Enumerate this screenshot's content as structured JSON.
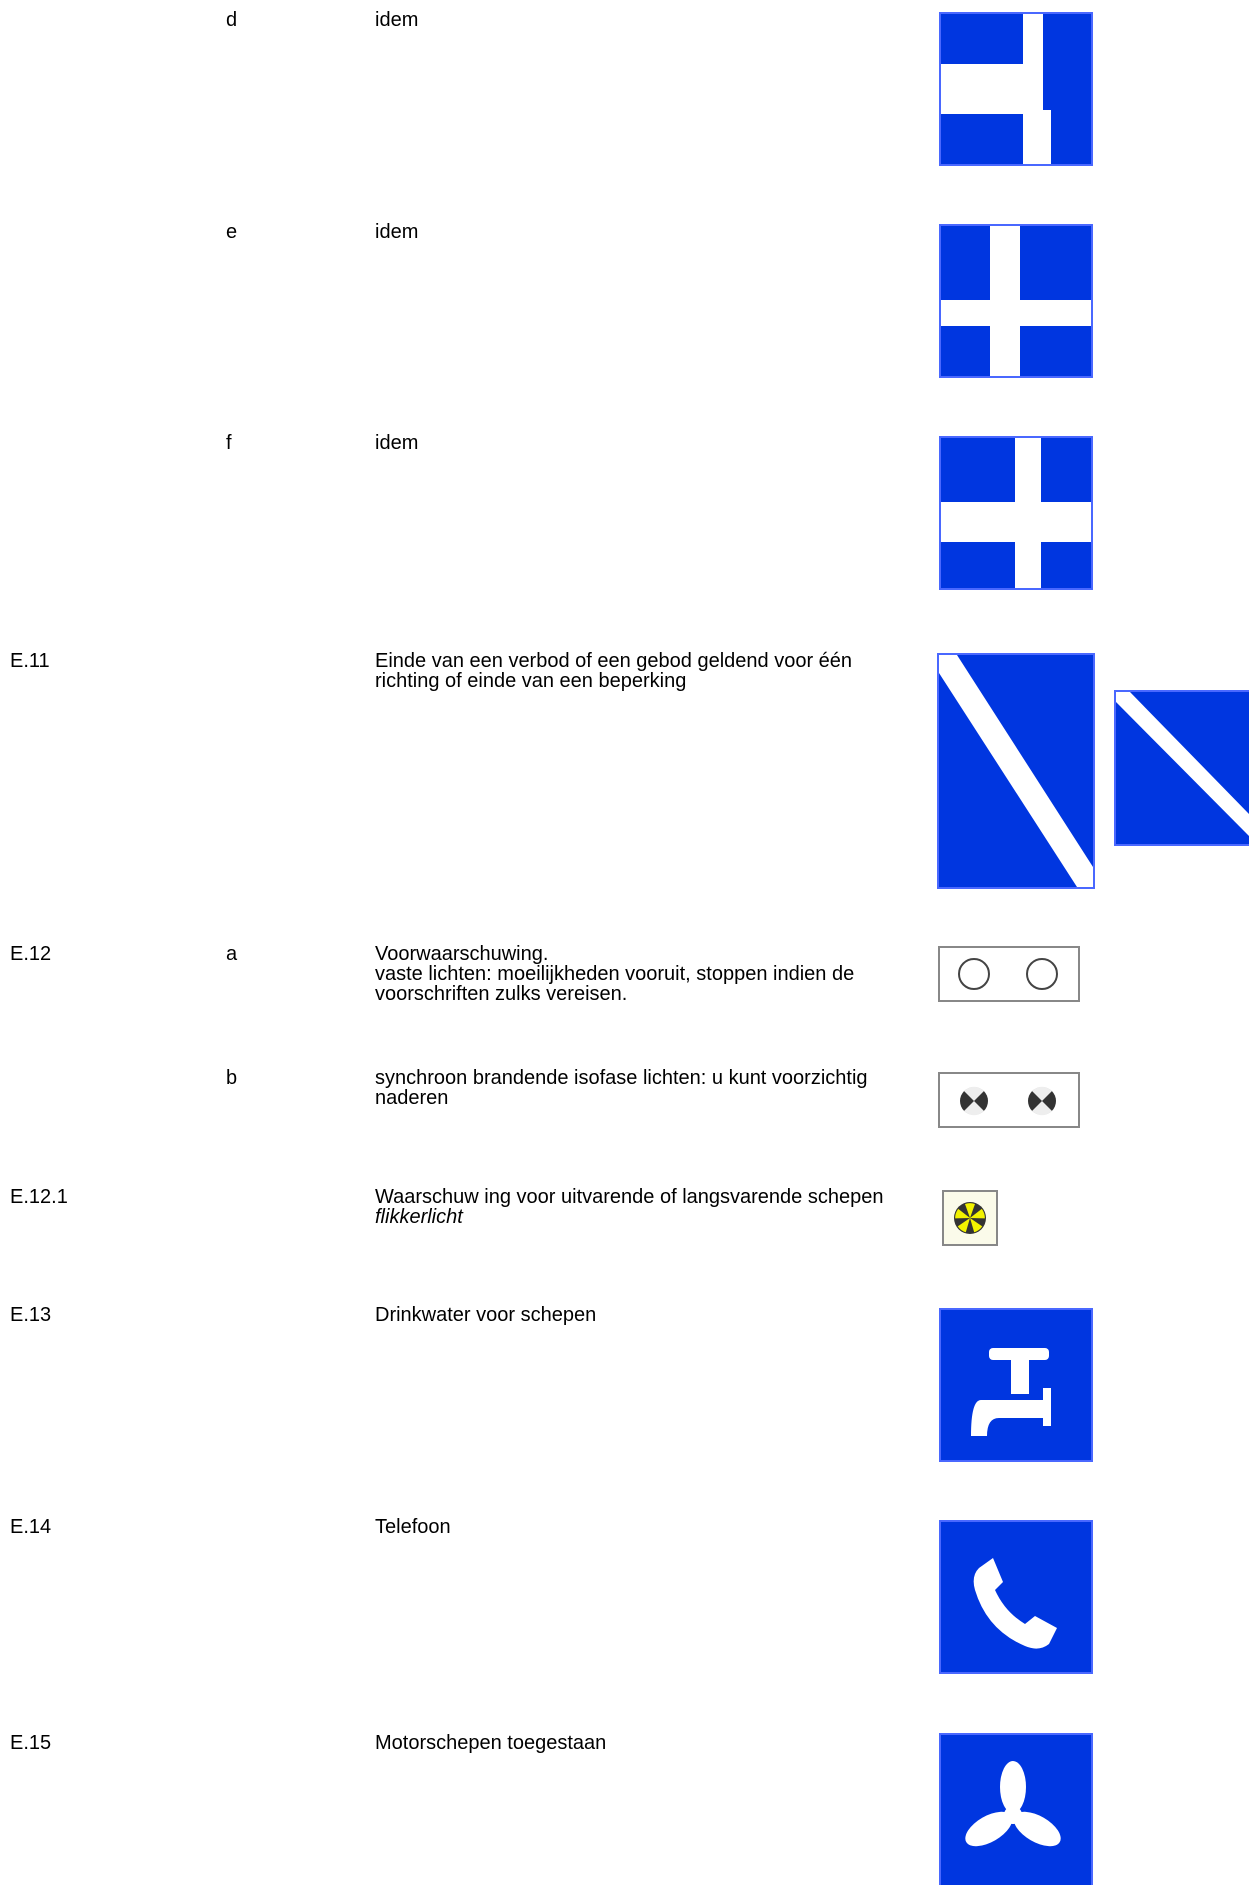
{
  "rows": [
    {
      "code": "",
      "sub": "d",
      "text": "idem"
    },
    {
      "code": "",
      "sub": "e",
      "text": "idem"
    },
    {
      "code": "",
      "sub": "f",
      "text": "idem"
    },
    {
      "code": "E.11",
      "sub": "",
      "text": "Einde van een verbod of een gebod geldend voor één richting of einde van een beperking",
      "text_lines": [
        "Einde van een verbod of een gebod geldend voor één",
        "richting of einde van een beperking"
      ]
    },
    {
      "code": "E.12",
      "sub": "a",
      "text_lines": [
        "Voorwaarschuwing.",
        "vaste lichten: moeilijkheden vooruit, stoppen indien de",
        "voorschriften zulks vereisen."
      ]
    },
    {
      "code": "",
      "sub": "b",
      "text_lines": [
        "synchroon brandende isofase lichten: u kunt voorzichtig",
        "naderen"
      ]
    },
    {
      "code": "E.12.1",
      "sub": "",
      "text_lines": [
        "Waarschuw ing voor uitvarende of langsvarende schepen"
      ],
      "italic_line": "flikkerlicht"
    },
    {
      "code": "E.13",
      "sub": "",
      "text": "Drinkwater voor schepen"
    },
    {
      "code": "E.14",
      "sub": "",
      "text": "Telefoon"
    },
    {
      "code": "E.15",
      "sub": "",
      "text": "Motorschepen toegestaan"
    }
  ],
  "colors": {
    "sign_blue": "#0036e0",
    "sign_border": "#4a68ff",
    "light_yellow": "#f2f200"
  },
  "icons": [
    "crossroads-sign-d",
    "crossroads-sign-e",
    "crossroads-sign-f",
    "end-of-restriction-sign",
    "fixed-lights-panel",
    "isophase-lights-panel",
    "flashing-light-panel",
    "drinking-water-tap-icon",
    "telephone-handset-icon",
    "propeller-icon"
  ]
}
